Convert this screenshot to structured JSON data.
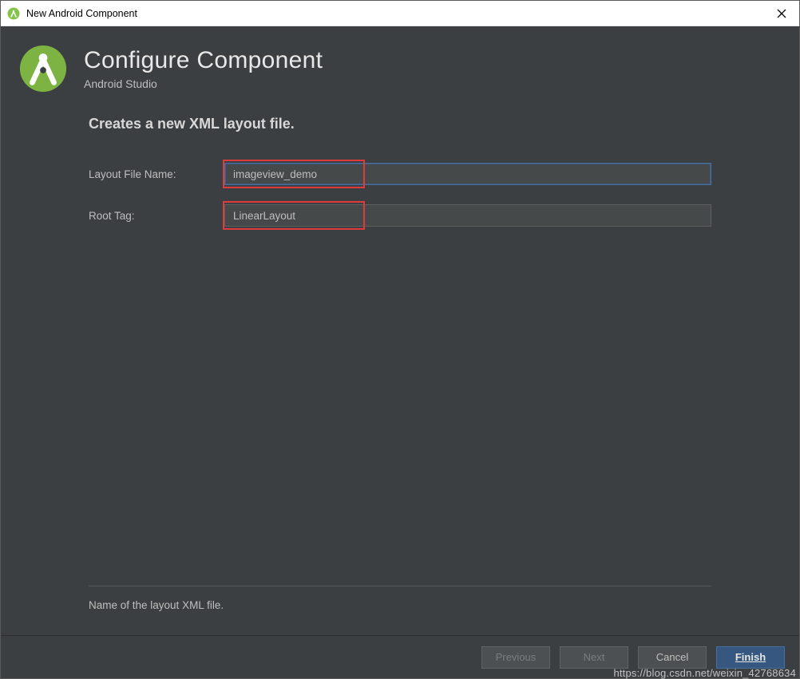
{
  "window": {
    "title": "New Android Component"
  },
  "header": {
    "title": "Configure Component",
    "subtitle": "Android Studio"
  },
  "body": {
    "heading": "Creates a new XML layout file.",
    "fields": {
      "layout_name": {
        "label": "Layout File Name:",
        "value": "imageview_demo"
      },
      "root_tag": {
        "label": "Root Tag:",
        "value": "LinearLayout"
      }
    },
    "hint": "Name of the layout XML file."
  },
  "footer": {
    "previous": "Previous",
    "next": "Next",
    "cancel": "Cancel",
    "finish": "Finish"
  },
  "watermark": "https://blog.csdn.net/weixin_42768634"
}
